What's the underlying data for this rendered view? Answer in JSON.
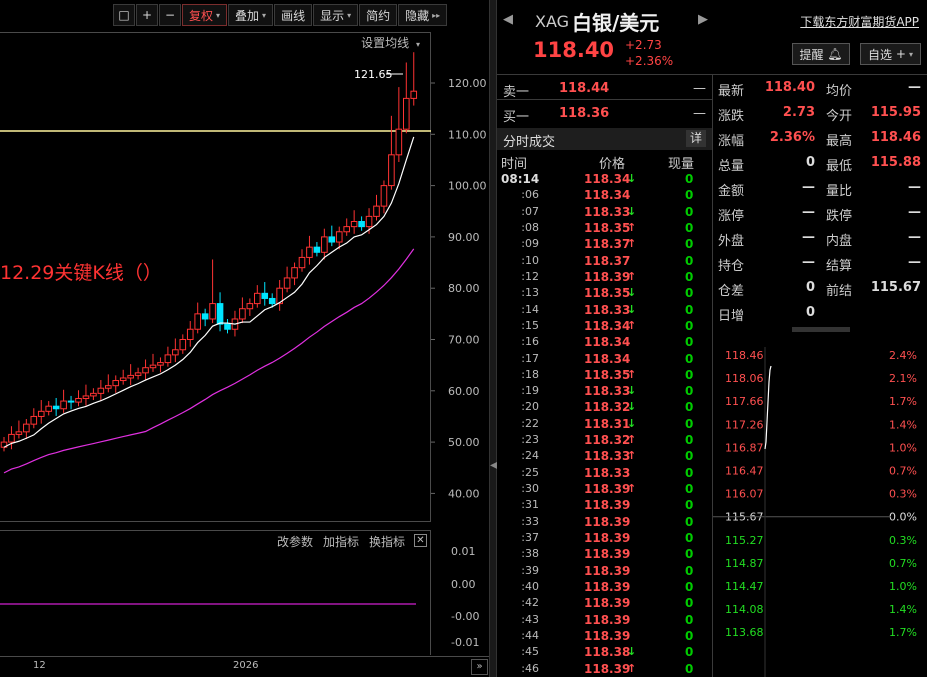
{
  "toolbar": {
    "buttons": [
      {
        "label": "复权",
        "caret": "▾"
      },
      {
        "label": "叠加",
        "caret": "▾"
      },
      {
        "label": "画线",
        "caret": ""
      },
      {
        "label": "显示",
        "caret": "▾"
      },
      {
        "label": "简约",
        "caret": ""
      },
      {
        "label": "隐藏",
        "caret": "▸▸"
      }
    ]
  },
  "kline": {
    "settings_label": "设置均线",
    "price_axis_labels": [
      "120.00",
      "110.00",
      "100.00",
      "90.00",
      "80.00",
      "70.00",
      "60.00",
      "50.00",
      "40.00"
    ],
    "high_marker": "121.65",
    "annotation": "12.29关键K线（）",
    "colors": {
      "up": "#ff3333",
      "down": "#00e5ff",
      "ma_short": "#ffffff",
      "ma_long": "#e030e0",
      "key_level": "#fff59d"
    }
  },
  "indicator": {
    "tools": [
      "改参数",
      "加指标",
      "换指标"
    ],
    "close_symbol": "✕",
    "axis_labels": [
      "0.01",
      "0.00",
      "-0.00",
      "-0.01"
    ]
  },
  "date_axis": {
    "labels": [
      "12",
      "2026"
    ],
    "scroll_symbol": "»"
  },
  "divider_symbol": "◀",
  "header": {
    "code": "XAG",
    "name": "白银/美元",
    "download_link": "下载东方财富期货APP",
    "price": "118.40",
    "change": "+2.73",
    "change_pct": "+2.36%",
    "alert_button": "提醒",
    "watchlist_button": "自选"
  },
  "order_book": [
    {
      "label": "卖一",
      "value": "118.44",
      "qty": "—"
    },
    {
      "label": "买一",
      "value": "118.36",
      "qty": "—"
    }
  ],
  "ticks": {
    "title": "分时成交",
    "detail_button": "详",
    "headers": {
      "time": "时间",
      "price": "价格",
      "volume": "现量"
    },
    "rows": [
      {
        "time": "08:14",
        "price": "118.34",
        "dir": "down",
        "vol": "0"
      },
      {
        "time": ":06",
        "price": "118.34",
        "dir": "",
        "vol": "0"
      },
      {
        "time": ":07",
        "price": "118.33",
        "dir": "down",
        "vol": "0"
      },
      {
        "time": ":08",
        "price": "118.35",
        "dir": "up",
        "vol": "0"
      },
      {
        "time": ":09",
        "price": "118.37",
        "dir": "up",
        "vol": "0"
      },
      {
        "time": ":10",
        "price": "118.37",
        "dir": "",
        "vol": "0"
      },
      {
        "time": ":12",
        "price": "118.39",
        "dir": "up",
        "vol": "0"
      },
      {
        "time": ":13",
        "price": "118.35",
        "dir": "down",
        "vol": "0"
      },
      {
        "time": ":14",
        "price": "118.33",
        "dir": "down",
        "vol": "0"
      },
      {
        "time": ":15",
        "price": "118.34",
        "dir": "up",
        "vol": "0"
      },
      {
        "time": ":16",
        "price": "118.34",
        "dir": "",
        "vol": "0"
      },
      {
        "time": ":17",
        "price": "118.34",
        "dir": "",
        "vol": "0"
      },
      {
        "time": ":18",
        "price": "118.35",
        "dir": "up",
        "vol": "0"
      },
      {
        "time": ":19",
        "price": "118.33",
        "dir": "down",
        "vol": "0"
      },
      {
        "time": ":20",
        "price": "118.32",
        "dir": "down",
        "vol": "0"
      },
      {
        "time": ":22",
        "price": "118.31",
        "dir": "down",
        "vol": "0"
      },
      {
        "time": ":23",
        "price": "118.32",
        "dir": "up",
        "vol": "0"
      },
      {
        "time": ":24",
        "price": "118.33",
        "dir": "up",
        "vol": "0"
      },
      {
        "time": ":25",
        "price": "118.33",
        "dir": "",
        "vol": "0"
      },
      {
        "time": ":30",
        "price": "118.39",
        "dir": "up",
        "vol": "0"
      },
      {
        "time": ":31",
        "price": "118.39",
        "dir": "",
        "vol": "0"
      },
      {
        "time": ":33",
        "price": "118.39",
        "dir": "",
        "vol": "0"
      },
      {
        "time": ":37",
        "price": "118.39",
        "dir": "",
        "vol": "0"
      },
      {
        "time": ":38",
        "price": "118.39",
        "dir": "",
        "vol": "0"
      },
      {
        "time": ":39",
        "price": "118.39",
        "dir": "",
        "vol": "0"
      },
      {
        "time": ":40",
        "price": "118.39",
        "dir": "",
        "vol": "0"
      },
      {
        "time": ":42",
        "price": "118.39",
        "dir": "",
        "vol": "0"
      },
      {
        "time": ":43",
        "price": "118.39",
        "dir": "",
        "vol": "0"
      },
      {
        "time": ":44",
        "price": "118.39",
        "dir": "",
        "vol": "0"
      },
      {
        "time": ":45",
        "price": "118.38",
        "dir": "down",
        "vol": "0"
      },
      {
        "time": ":46",
        "price": "118.39",
        "dir": "up",
        "vol": "0"
      }
    ]
  },
  "stats": [
    {
      "l1": "最新",
      "v1": "118.40",
      "c1": "red",
      "l2": "均价",
      "v2": "—",
      "c2": "white"
    },
    {
      "l1": "涨跌",
      "v1": "2.73",
      "c1": "red",
      "l2": "今开",
      "v2": "115.95",
      "c2": "red"
    },
    {
      "l1": "涨幅",
      "v1": "2.36%",
      "c1": "red",
      "l2": "最高",
      "v2": "118.46",
      "c2": "red"
    },
    {
      "l1": "总量",
      "v1": "0",
      "c1": "white",
      "l2": "最低",
      "v2": "115.88",
      "c2": "red"
    },
    {
      "l1": "金额",
      "v1": "—",
      "c1": "white",
      "l2": "量比",
      "v2": "—",
      "c2": "white"
    },
    {
      "l1": "涨停",
      "v1": "—",
      "c1": "white",
      "l2": "跌停",
      "v2": "—",
      "c2": "white"
    },
    {
      "l1": "外盘",
      "v1": "—",
      "c1": "white",
      "l2": "内盘",
      "v2": "—",
      "c2": "white"
    },
    {
      "l1": "持仓",
      "v1": "—",
      "c1": "white",
      "l2": "结算",
      "v2": "—",
      "c2": "white"
    },
    {
      "l1": "仓差",
      "v1": "0",
      "c1": "white",
      "l2": "前结",
      "v2": "115.67",
      "c2": "white"
    },
    {
      "l1": "日增",
      "v1": "0",
      "c1": "white",
      "l2": "",
      "v2": "",
      "c2": "white"
    }
  ],
  "intraday": {
    "price_labels": [
      {
        "price": "118.46",
        "pct": "2.4%",
        "color": "#ff5050"
      },
      {
        "price": "118.06",
        "pct": "2.1%",
        "color": "#ff5050"
      },
      {
        "price": "117.66",
        "pct": "1.7%",
        "color": "#ff5050"
      },
      {
        "price": "117.26",
        "pct": "1.4%",
        "color": "#ff5050"
      },
      {
        "price": "116.87",
        "pct": "1.0%",
        "color": "#ff5050"
      },
      {
        "price": "116.47",
        "pct": "0.7%",
        "color": "#ff5050"
      },
      {
        "price": "116.07",
        "pct": "0.3%",
        "color": "#ff5050"
      },
      {
        "price": "115.67",
        "pct": "0.0%",
        "color": "#dddddd"
      },
      {
        "price": "115.27",
        "pct": "0.3%",
        "color": "#22dd22"
      },
      {
        "price": "114.87",
        "pct": "0.7%",
        "color": "#22dd22"
      },
      {
        "price": "114.47",
        "pct": "1.0%",
        "color": "#22dd22"
      },
      {
        "price": "114.08",
        "pct": "1.4%",
        "color": "#22dd22"
      },
      {
        "price": "113.68",
        "pct": "1.7%",
        "color": "#22dd22"
      }
    ]
  }
}
